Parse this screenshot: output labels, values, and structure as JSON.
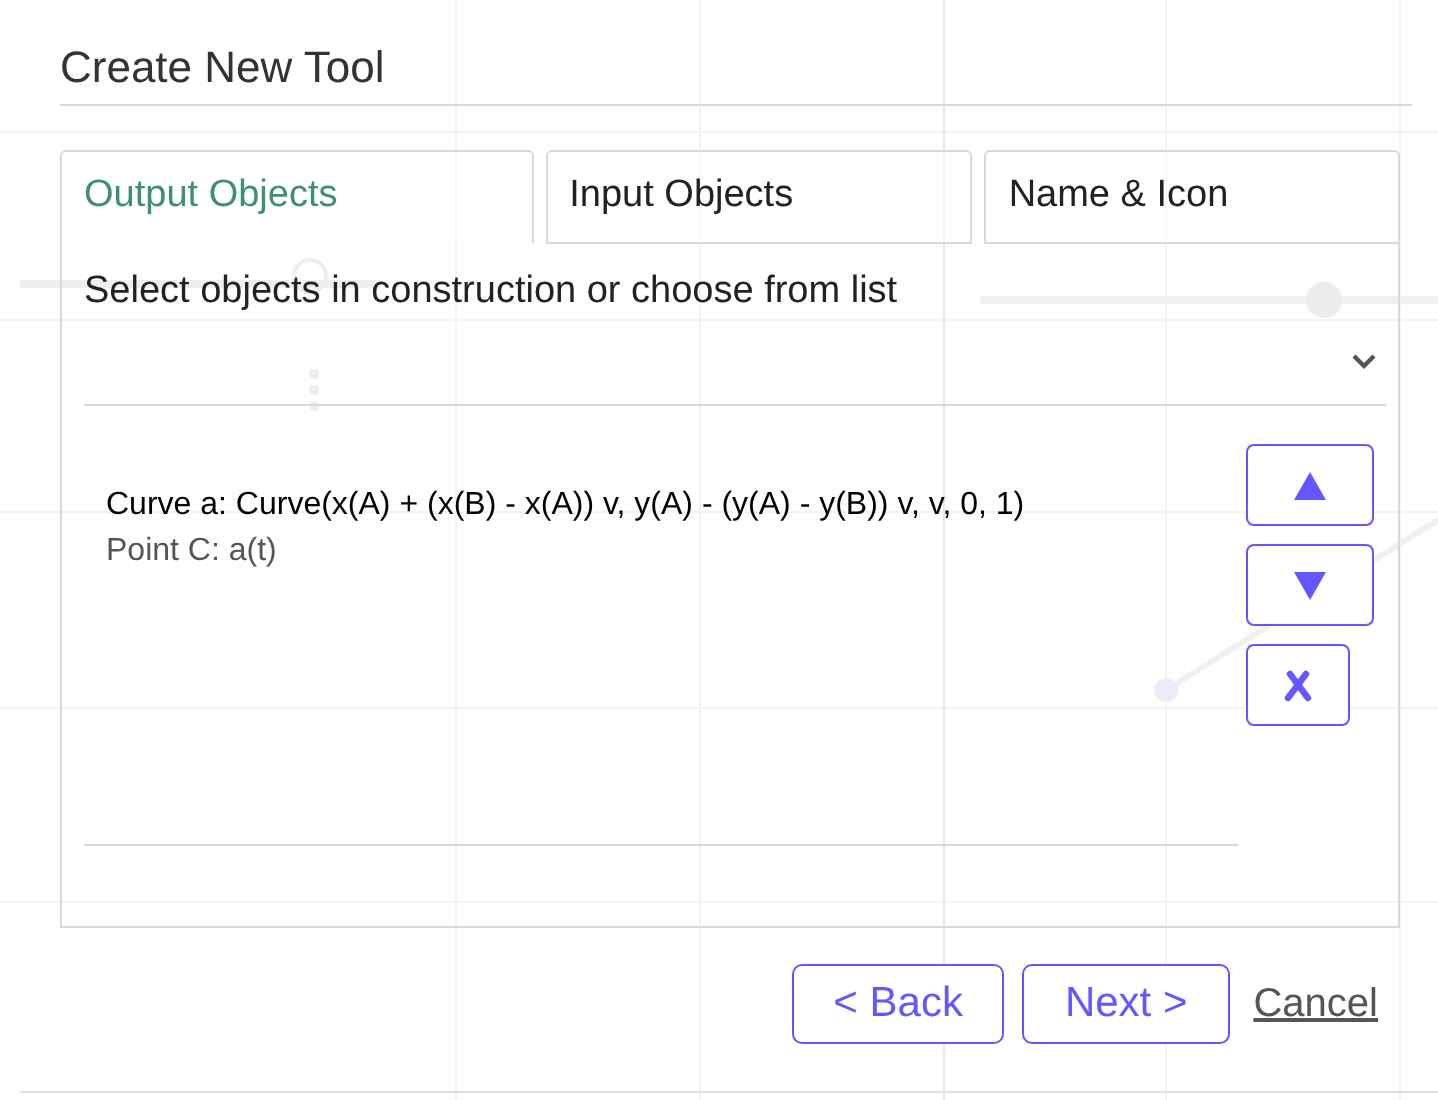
{
  "dialog": {
    "title": "Create New Tool",
    "tabs": [
      {
        "label": "Output Objects",
        "selected": true
      },
      {
        "label": "Input Objects",
        "selected": false
      },
      {
        "label": "Name & Icon",
        "selected": false
      }
    ],
    "instruction": "Select objects in construction or choose from list",
    "output_objects": [
      {
        "text": "Curve a: Curve(x(A) + (x(B) - x(A)) v, y(A) - (y(A) - y(B)) v, v, 0, 1)",
        "selected": true
      },
      {
        "text": "Point C: a(t)",
        "selected": false
      }
    ],
    "list_buttons": [
      {
        "kind": "up"
      },
      {
        "kind": "down"
      },
      {
        "kind": "remove"
      }
    ],
    "footer_buttons": [
      {
        "label": "< Back",
        "kind": "outlined"
      },
      {
        "label": "Next >",
        "kind": "outlined"
      },
      {
        "label": "Cancel",
        "kind": "link"
      }
    ]
  }
}
